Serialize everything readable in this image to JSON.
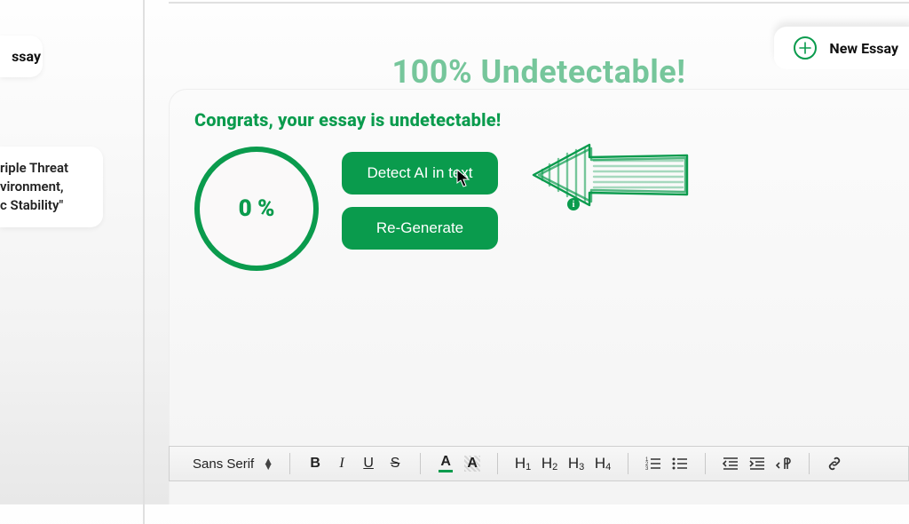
{
  "sidebar": {
    "item1": "ssay",
    "item2_l1": "riple Threat",
    "item2_l2": "vironment,",
    "item2_l3": "c Stability\""
  },
  "header": {
    "banner": "100% Undetectable!",
    "new_essay": "New Essay"
  },
  "main": {
    "congrats": "Congrats, your essay is undetectable!",
    "percent": "0 %",
    "detect_btn": "Detect AI in text",
    "regen_btn": "Re-Generate",
    "info": "i"
  },
  "toolbar": {
    "font": "Sans Serif",
    "bold": "B",
    "italic": "I",
    "underline": "U",
    "strike": "S",
    "color": "A",
    "highlight": "A",
    "h1a": "H",
    "h1b": "1",
    "h2a": "H",
    "h2b": "2",
    "h3a": "H",
    "h3b": "3",
    "h4a": "H",
    "h4b": "4"
  },
  "watermark": {
    "l1": "",
    "l2": ""
  }
}
